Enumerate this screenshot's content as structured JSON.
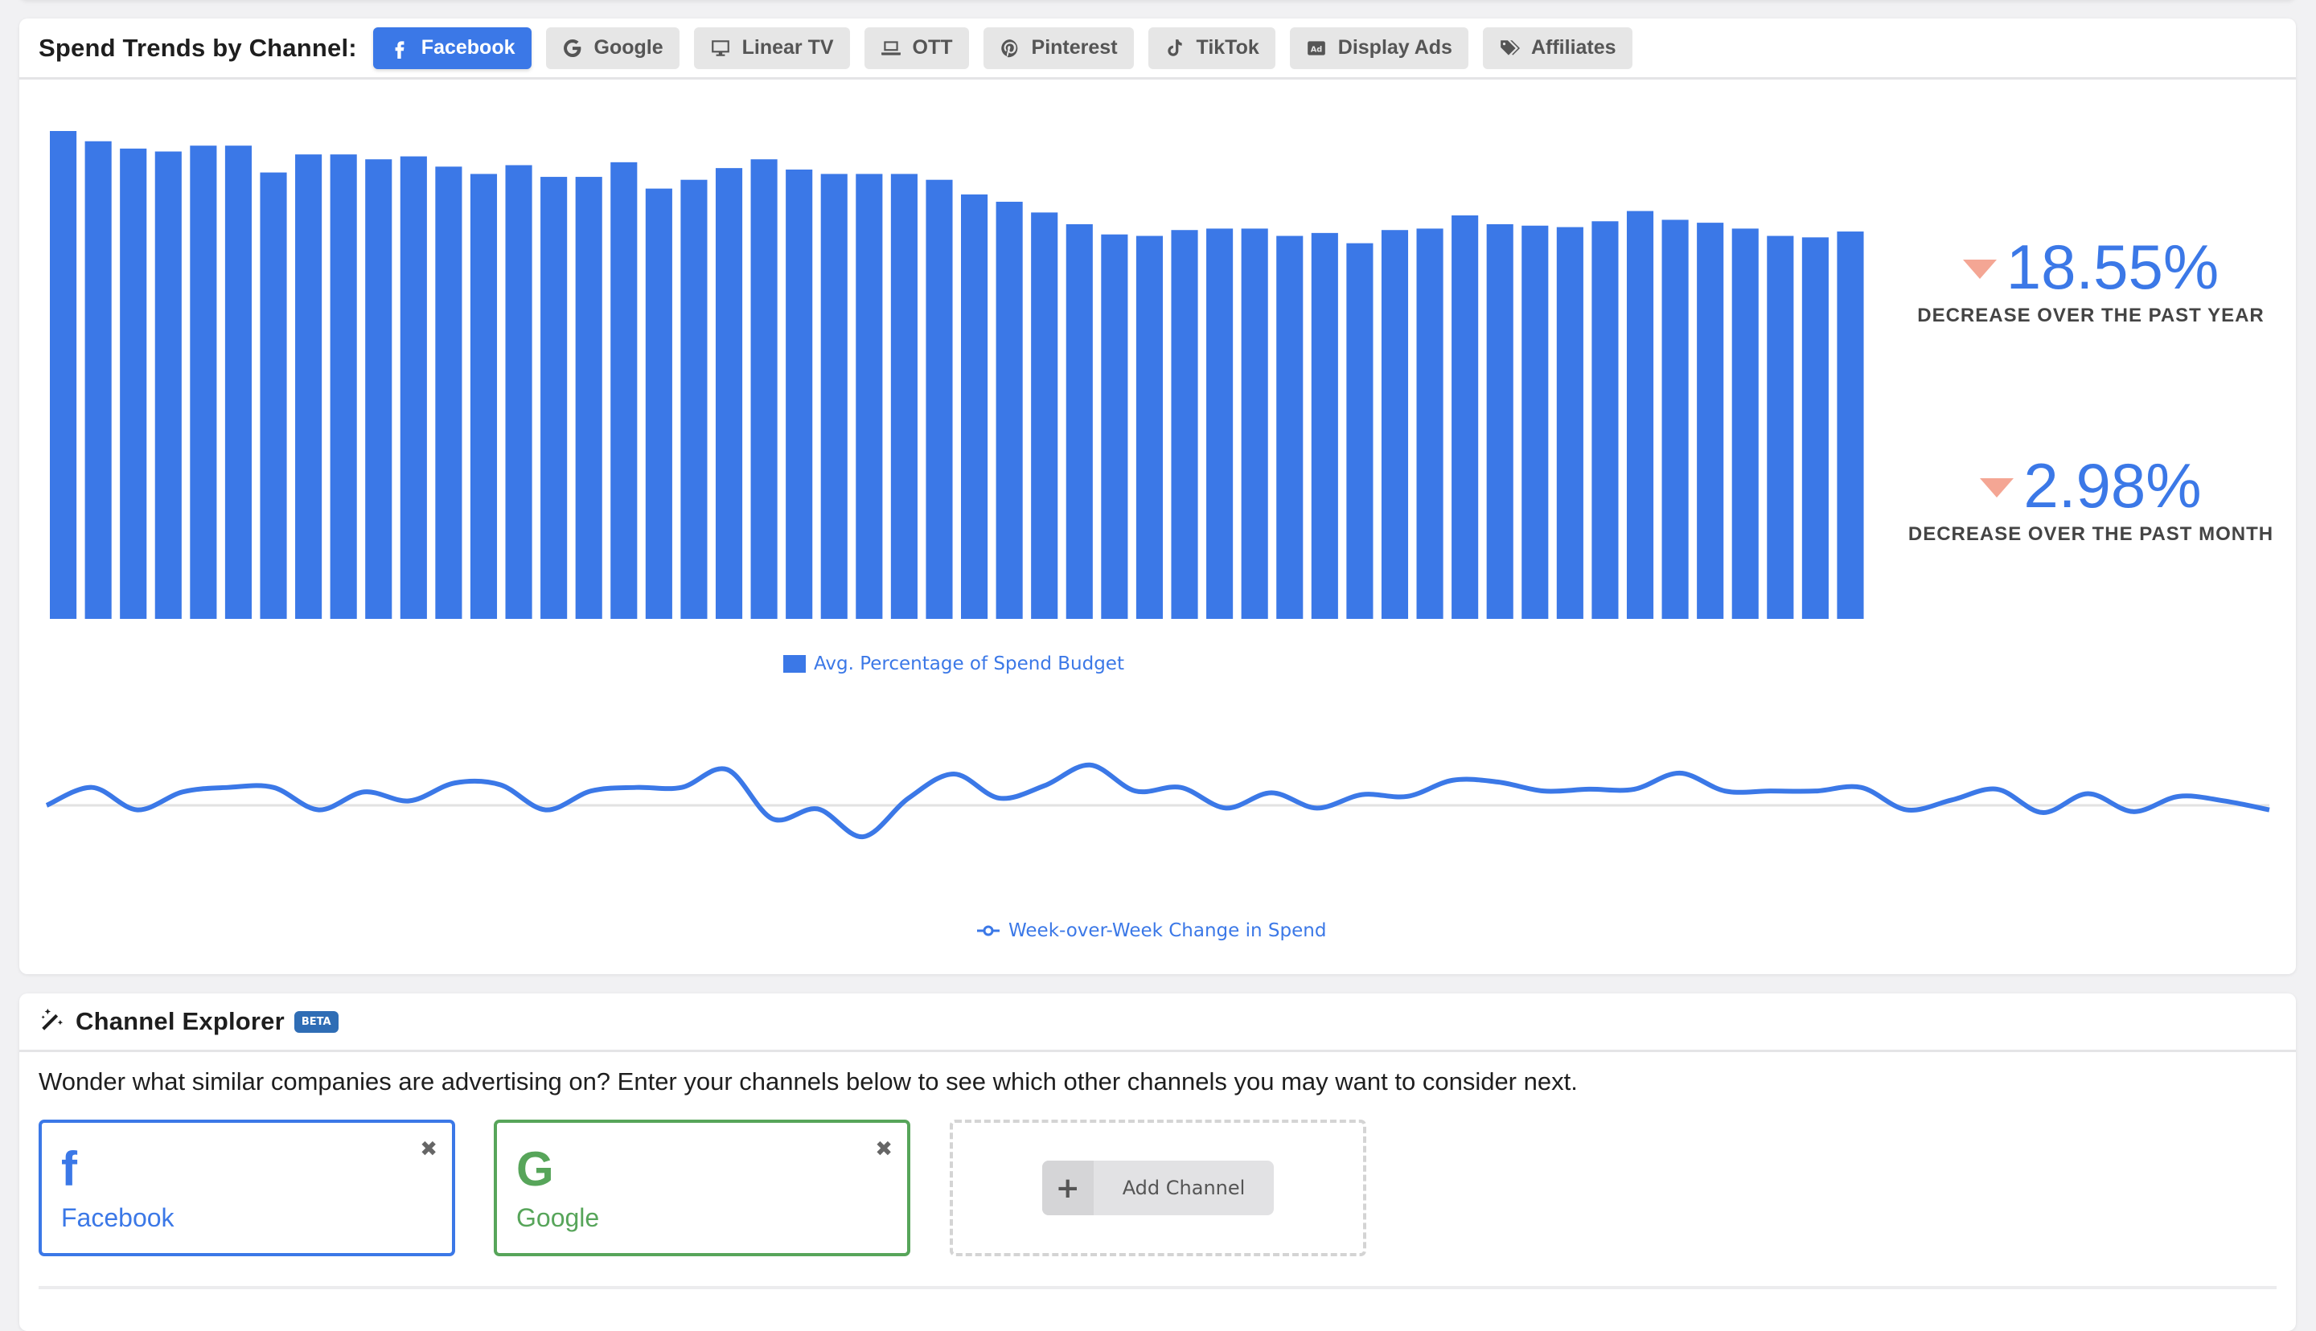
{
  "trend_card": {
    "title": "Spend Trends by Channel:",
    "tabs": [
      {
        "label": "Facebook",
        "icon": "facebook-icon",
        "active": true
      },
      {
        "label": "Google",
        "icon": "google-icon",
        "active": false
      },
      {
        "label": "Linear TV",
        "icon": "desktop-monitor-icon",
        "active": false
      },
      {
        "label": "OTT",
        "icon": "laptop-icon",
        "active": false
      },
      {
        "label": "Pinterest",
        "icon": "pinterest-icon",
        "active": false
      },
      {
        "label": "TikTok",
        "icon": "tiktok-icon",
        "active": false
      },
      {
        "label": "Display Ads",
        "icon": "ad-icon",
        "active": false
      },
      {
        "label": "Affiliates",
        "icon": "tags-icon",
        "active": false
      }
    ],
    "stats": [
      {
        "value": "18.55%",
        "label": "DECREASE OVER THE PAST YEAR",
        "direction": "down"
      },
      {
        "value": "2.98%",
        "label": "DECREASE OVER THE PAST MONTH",
        "direction": "down"
      }
    ]
  },
  "chart_data": [
    {
      "type": "bar",
      "title": "",
      "xlabel": "",
      "ylabel": "",
      "legend": "bottom",
      "series": [
        {
          "name": "Avg. Percentage of Spend Budget",
          "color": "#3b78e7"
        }
      ],
      "values": [
        100,
        97.9,
        96.4,
        95.8,
        97.0,
        97.0,
        91.5,
        95.2,
        95.2,
        94.2,
        94.8,
        92.7,
        91.2,
        93.0,
        90.6,
        90.6,
        93.6,
        88.2,
        90.0,
        92.4,
        94.2,
        92.1,
        91.2,
        91.2,
        91.2,
        90.0,
        87.0,
        85.5,
        83.3,
        80.9,
        78.8,
        78.5,
        79.7,
        80.0,
        80.0,
        78.5,
        79.1,
        77.0,
        79.7,
        80.0,
        82.7,
        80.9,
        80.6,
        80.3,
        81.5,
        83.6,
        81.8,
        81.2,
        80.0,
        78.5,
        78.2,
        79.4
      ],
      "ylim": [
        0,
        100
      ],
      "grid": false
    },
    {
      "type": "line",
      "title": "",
      "legend": "bottom",
      "series": [
        {
          "name": "Week-over-Week Change in Spend",
          "color": "#3b78e7"
        }
      ],
      "values": [
        0,
        2.0,
        -0.5,
        1.5,
        2.0,
        2.0,
        -0.5,
        1.5,
        0.5,
        2.5,
        2.3,
        -0.5,
        1.6,
        2.0,
        2.0,
        4.0,
        -1.5,
        -0.4,
        -3.5,
        0.8,
        3.5,
        0.8,
        2.2,
        4.5,
        1.6,
        2.0,
        -0.3,
        1.4,
        -0.3,
        1.2,
        1.0,
        2.8,
        2.6,
        1.6,
        1.8,
        1.8,
        3.6,
        1.6,
        1.6,
        1.6,
        2.0,
        -0.5,
        0.6,
        1.8,
        -0.8,
        1.3,
        -0.7,
        1.0,
        0.5,
        -0.5
      ],
      "ylim": [
        -8,
        8
      ],
      "zero_line": true
    }
  ],
  "explorer_card": {
    "title": "Channel Explorer",
    "badge": "BETA",
    "description": "Wonder what similar companies are advertising on? Enter your channels below to see which other channels you may want to consider next.",
    "channels": [
      {
        "name": "Facebook",
        "logo": "f",
        "color": "#3b78e7"
      },
      {
        "name": "Google",
        "logo": "G",
        "color": "#57a55a"
      }
    ],
    "close_glyph": "✖",
    "add_button": {
      "plus": "+",
      "label": "Add Channel"
    }
  },
  "colors": {
    "accent": "#3b78e7",
    "decrease_arrow": "#f4a694",
    "google_green": "#57a55a",
    "badge": "#2f6db5"
  }
}
